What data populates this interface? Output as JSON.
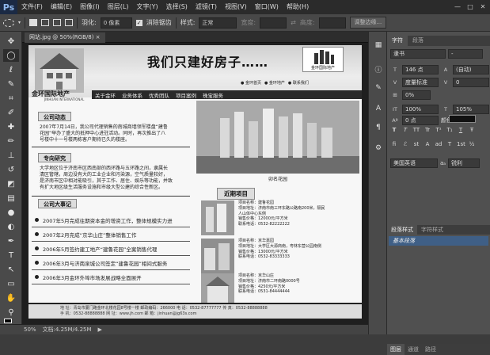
{
  "app": {
    "logo": "Ps"
  },
  "menu": [
    "文件(F)",
    "编辑(E)",
    "图像(I)",
    "图层(L)",
    "文字(Y)",
    "选择(S)",
    "滤镜(T)",
    "视图(V)",
    "窗口(W)",
    "帮助(H)"
  ],
  "window_controls": {
    "minimize": "—",
    "restore": "□",
    "close": "✕"
  },
  "options": {
    "feather_label": "羽化:",
    "feather_value": "0 像素",
    "antialias_label": "消除锯齿",
    "style_label": "样式:",
    "style_value": "正常",
    "width_label": "宽度:",
    "height_label": "高度:",
    "refine_button": "调整边缘..."
  },
  "document_tab": {
    "label": "网站.jpg @ 50%(RGB/8)",
    "close": "×"
  },
  "canvas": {
    "headline": "我们只建好房子……",
    "brand": "金环国际地产",
    "brand_sub": "JINHUAN INTERNATIONAL",
    "logo_text": "金环国际地产",
    "subnav": [
      "● 金环首页",
      "● 金环地产",
      "● 联系我们"
    ],
    "nav": [
      "关于金环",
      "业务体系",
      "优秀团队",
      "项目案例",
      "珠宝服务"
    ],
    "news_title": "公司动态",
    "news_text": "2007年7月14日，我公司代理销售的南城商墙领军楼盘“建鲁\n花园”举办了盛大的抵押中心进驻活动。同时，再次推出了八\n号楼中十一号楼两栋客户期待已久的楼座。",
    "profile_title": "专向研究",
    "profile_text": "大学地区位于济南市区西南部的西环路与五环路之间，隶属长\n清区管辖，周边没有大的工业企业和污染源，空气质量较好，\n是济南市区中相对能吸引，其于工作、居住、娱乐等功能，并致\n有扩大地区级生活服务设施和市级大型公建的综合性新区。",
    "events_title": "公司大事记",
    "events": [
      "2007年5月完成往期资本金的增资工作，整体规模实力进",
      "2007年2月完成“京华山庄”整体销售工作",
      "2006年5月签约建工地产“建鲁花园”全案销售代理",
      "2006年3月与济南泉城公司签定“建鲁花园”相间式服务",
      "2006年3月金环外埠市场发展战略全面展开"
    ],
    "main_photo_caption": "卯名花园",
    "recent_title": "近期项目",
    "projects": [
      {
        "text": "项目名称：建鲁花园\n项目地址：济南市南三环东路公路南200米，隔民\n人山体中心东侧\n销售价格：12000元/平方米\n联系电话：0532-82222222"
      },
      {
        "text": "项目名称：京华嘉园\n项目地址：大学区大源商南，粤林东营公园南侧\n销售价格：13000元/平方米\n联系电话：0532-83333333"
      },
      {
        "text": "项目名称：京华山庄\n项目地址：济南市二环南路0000号\n销售价格：4250元/平方米\n联系电话：0531-84444444"
      }
    ],
    "footer": "地  址：青岛市厦门路金环北楼花园8号楼一楼     邮政编码：266000     电  话：0532-87777777  传  真：0532-88888888\n手  机：0532-88888888     网  址：www.jh.com     邮  箱：jinhuan@jg63s.com"
  },
  "status": {
    "zoom": "50%",
    "doc": "文档:4.25M/4.25M",
    "arrow": "▶"
  },
  "panel": {
    "tabs": [
      "字符",
      "段落"
    ],
    "font_family": "隶书",
    "font_style": "-",
    "font_size": "146 点",
    "leading": "(自动)",
    "kerning": "度量标准",
    "tracking": "0",
    "scale_pct": "0%",
    "vscale": "100%",
    "hscale": "105%",
    "baseline": "0 点",
    "color_label": "颜色:",
    "font_styles": [
      "T",
      "T",
      "TT",
      "Tr",
      "T¹",
      "T₁",
      "T",
      "Ŧ"
    ],
    "extras": [
      "fi",
      "ℰ",
      "st",
      "A",
      "ad",
      "T",
      "1st",
      "½"
    ],
    "language": "美国英语",
    "aa_label": "aₐ",
    "aa_value": "锐利",
    "tabs2": [
      "段落样式",
      "字符样式"
    ],
    "style_row": "基本段落",
    "bottom_tabs": [
      "图层",
      "通道",
      "路径"
    ]
  }
}
